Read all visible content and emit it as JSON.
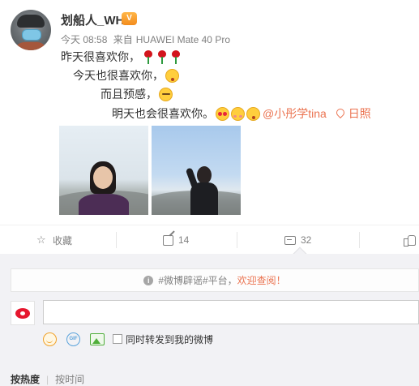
{
  "post": {
    "username": "划船人_WH",
    "timestamp": "今天 08:58",
    "source_prefix": "来自",
    "device": "HUAWEI Mate 40 Pro",
    "lines": [
      "昨天很喜欢你，",
      "今天也很喜欢你，",
      "而且预感，",
      "明天也会很喜欢你。"
    ],
    "mention": "@小彤学tina",
    "location": "日照"
  },
  "actions": {
    "favorite_label": "收藏",
    "repost_count": "14",
    "comment_count": "32"
  },
  "comment_box": {
    "notice_prefix": "#微博辟谣#平台，",
    "notice_link": "欢迎查阅！",
    "input_value": "",
    "also_repost_label": "同时转发到我的微博"
  },
  "sort": {
    "hot": "按热度",
    "separator": "|",
    "time": "按时间"
  },
  "colors": {
    "accent": "#eb7350",
    "weibo_red": "#e6162d",
    "muted_text": "#808080"
  }
}
